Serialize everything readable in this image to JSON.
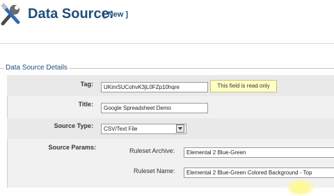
{
  "header": {
    "icon": "tools-icon",
    "title": "Data Source:",
    "status": "[ New ]"
  },
  "section": {
    "legend": "Data Source Details"
  },
  "fields": {
    "tag": {
      "label": "Tag:",
      "value": "UKimSUCohvK3jL0FZp10hqre",
      "tooltip": "This field is read only"
    },
    "title": {
      "label": "Title:",
      "value": "Google Spreadsheet Demo"
    },
    "source_type": {
      "label": "Source Type:",
      "value": "CSV/Text File"
    },
    "source_params": {
      "label": "Source Params:"
    },
    "ruleset_archive": {
      "label": "Ruleset Archive:",
      "value": "Elemental 2 Blue-Green"
    },
    "ruleset_name": {
      "label": "Ruleset Name:",
      "value": "Elemental 2 Blue-Green Colored Background - Top"
    }
  },
  "colors": {
    "title_blue": "#1f4f7a",
    "tooltip_bg": "#ffffc4",
    "panel_bg": "#f1f1f1"
  }
}
